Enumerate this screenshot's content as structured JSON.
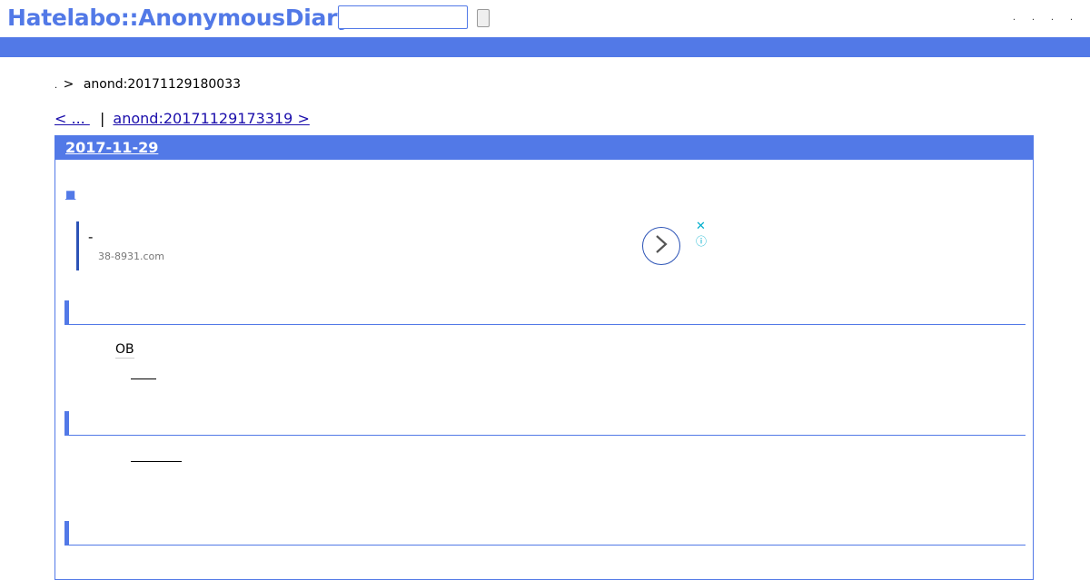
{
  "header": {
    "logo": "Hatelabo::AnonymousDiary",
    "search": {
      "value": "",
      "placeholder": ""
    },
    "links": [
      ".",
      ".",
      ".",
      "."
    ]
  },
  "breadcrumb": {
    "home": ".",
    "separator": ">",
    "current": "anond:20171129180033"
  },
  "pager": {
    "prev": "< ... ",
    "pipe": "|",
    "next": "anond:20171129173319 >"
  },
  "day": {
    "date": "2017-11-29",
    "section_marker": "■",
    "ad": {
      "title": "-",
      "domain": "38-8931.com",
      "close": "✕",
      "info": "ⓘ"
    },
    "paragraphs": {
      "ob": "OB"
    }
  },
  "colors": {
    "accent": "#5279e7",
    "ad_border": "#2c53b6",
    "ad_icon": "#00aecd"
  }
}
